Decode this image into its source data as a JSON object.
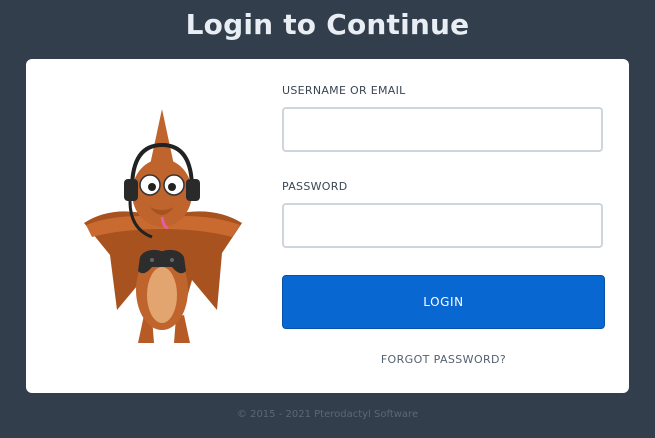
{
  "page": {
    "title": "Login to Continue"
  },
  "form": {
    "username_label": "USERNAME OR EMAIL",
    "username_value": "",
    "password_label": "PASSWORD",
    "password_value": "",
    "login_label": "LOGIN",
    "forgot_label": "FORGOT PASSWORD?"
  },
  "footer": {
    "copyright": "© 2015 - 2021 Pterodactyl Software"
  },
  "mascot": {
    "icon": "pterodactyl-mascot-icon"
  },
  "colors": {
    "background": "#323e4b",
    "card": "#ffffff",
    "primary_button": "#0967d2",
    "mascot_body": "#c0642e"
  }
}
